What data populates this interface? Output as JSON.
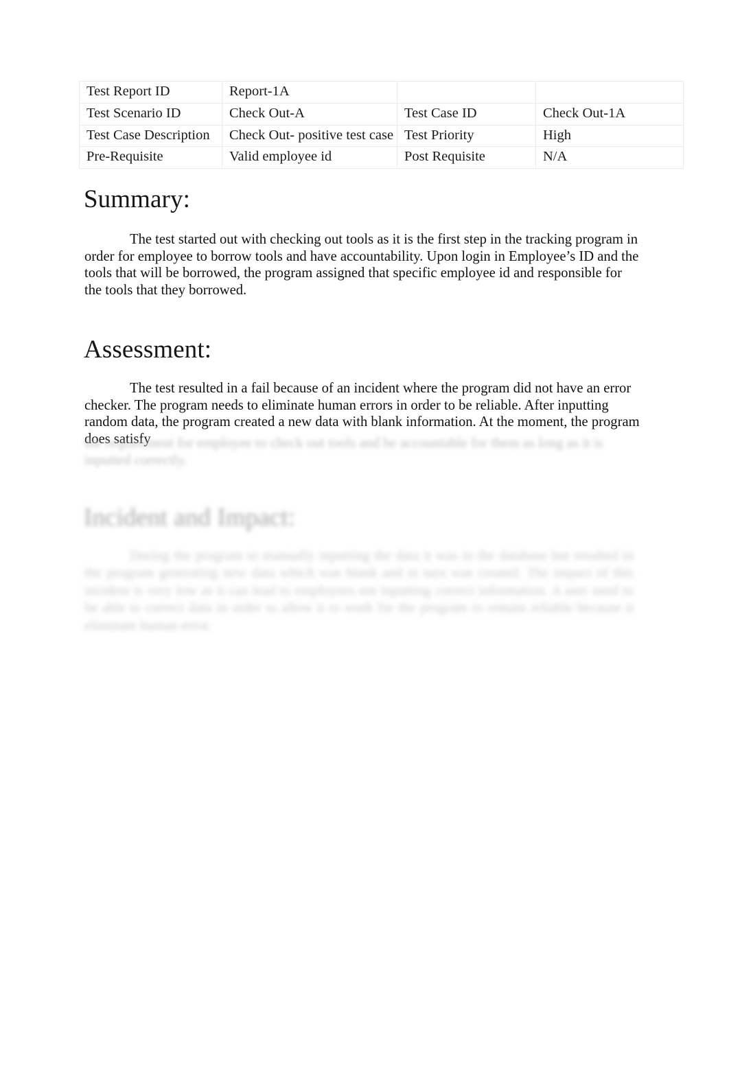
{
  "document": {
    "table": {
      "rows": [
        {
          "cells": [
            "Test Report ID",
            "Report-1A",
            "",
            ""
          ]
        },
        {
          "cells": [
            "Test Scenario ID",
            "Check Out-A",
            "Test Case ID",
            "Check Out-1A"
          ]
        },
        {
          "cells": [
            "Test Case Description",
            "Check Out- positive test case",
            "Test Priority",
            "High"
          ]
        },
        {
          "cells": [
            "Pre-Requisite",
            "Valid employee id",
            "Post Requisite",
            "N/A"
          ]
        }
      ]
    },
    "sections": {
      "summary": {
        "heading": "Summary:",
        "body": "The test started out with checking out tools as it is the first step in the tracking program in order for employee to borrow tools and have accountability. Upon login in Employee’s ID and the tools that will be borrowed, the program assigned that specific employee id and responsible for the tools that they borrowed."
      },
      "assessment": {
        "heading": "Assessment:",
        "body": "The test resulted in a fail because of an incident where the program did not have an error checker. The program needs to eliminate human errors in order to be reliable. After inputting random data, the program created a new data with blank information. At the moment, the program does satisfy",
        "body_blurred": "the requirement for employee to check out tools and be accountable for them as long as it is inputted correctly."
      },
      "incident": {
        "heading": "Incident and Impact:",
        "body_blurred": "During the program to manually inputting the data it was in the database but resulted in the program generating new data which was blank and in turn was created. The impact of this incident is very low as it can lead to employees not inputting correct information. A user need to be able to correct data in order to allow it to work for the program to remain reliable because it eliminate human error."
      }
    }
  }
}
